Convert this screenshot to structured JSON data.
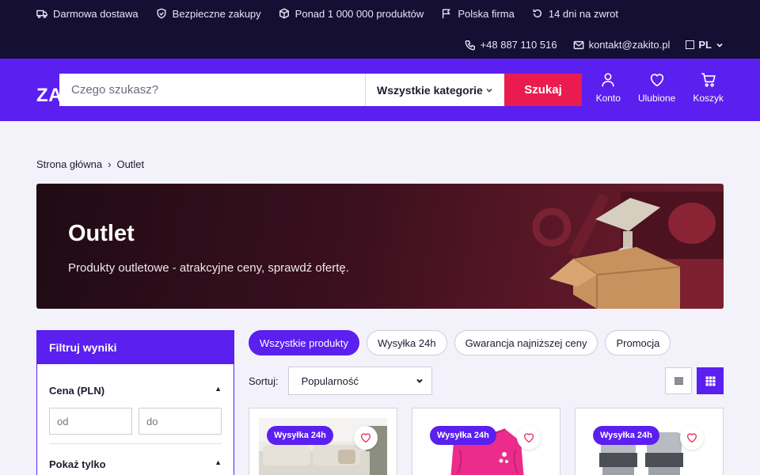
{
  "perks": [
    {
      "icon": "truck-icon",
      "label": "Darmowa dostawa"
    },
    {
      "icon": "shield-icon",
      "label": "Bezpieczne zakupy"
    },
    {
      "icon": "box-icon",
      "label": "Ponad 1 000 000 produktów"
    },
    {
      "icon": "flag-icon",
      "label": "Polska firma"
    },
    {
      "icon": "return-icon",
      "label": "14 dni na zwrot"
    }
  ],
  "contact": {
    "phone": "+48 887 110 516",
    "email": "kontakt@zakito.pl",
    "lang": "PL"
  },
  "header": {
    "logo": "ZA",
    "search_placeholder": "Czego szukasz?",
    "category": "Wszystkie kategorie",
    "search_button": "Szukaj",
    "actions": [
      {
        "icon": "user-icon",
        "label": "Konto"
      },
      {
        "icon": "heart-icon",
        "label": "Ulubione"
      },
      {
        "icon": "cart-icon",
        "label": "Koszyk"
      }
    ]
  },
  "breadcrumb": {
    "home": "Strona główna",
    "sep": "›",
    "current": "Outlet"
  },
  "hero": {
    "title": "Outlet",
    "subtitle": "Produkty outletowe - atrakcyjne ceny, sprawdź ofertę."
  },
  "filters": {
    "title": "Filtruj wyniki",
    "price_title": "Cena (PLN)",
    "price_from_placeholder": "od",
    "price_to_placeholder": "do",
    "show_only_title": "Pokaż tylko",
    "caret": "▲"
  },
  "chips": [
    {
      "label": "Wszystkie produkty",
      "active": true
    },
    {
      "label": "Wysyłka 24h",
      "active": false
    },
    {
      "label": "Gwarancja najniższej ceny",
      "active": false
    },
    {
      "label": "Promocja",
      "active": false
    }
  ],
  "sort": {
    "label": "Sortuj:",
    "value": "Popularność"
  },
  "products": [
    {
      "badge": "Wysyłka 24h",
      "image": "sofa"
    },
    {
      "badge": "Wysyłka 24h",
      "image": "pink-sweater"
    },
    {
      "badge": "Wysyłka 24h",
      "image": "water-filters"
    }
  ],
  "colors": {
    "brand": "#5b1ff0",
    "accent": "#ea1c4f",
    "topbar": "#150f33"
  }
}
